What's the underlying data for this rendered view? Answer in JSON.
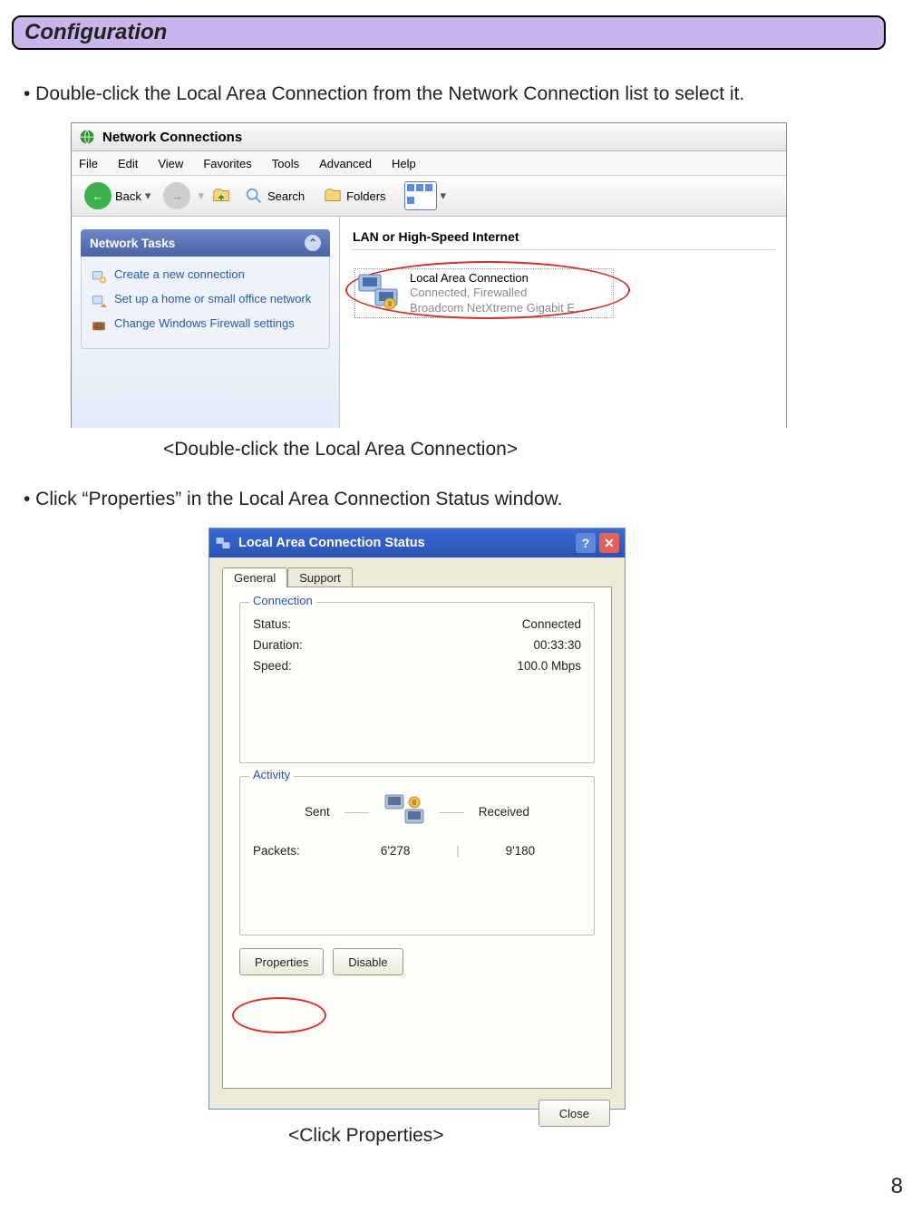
{
  "header": {
    "title": "Configuration"
  },
  "bullets": {
    "b1": "• Double-click the Local Area Connection from the Network Connection list to select it.",
    "b2": "• Click “Properties” in the Local Area Connection Status window."
  },
  "captions": {
    "c1": "<Double-click the Local Area Connection>",
    "c2": "<Click Properties>"
  },
  "page_number": "8",
  "shot1": {
    "title": "Network Connections",
    "menu": [
      "File",
      "Edit",
      "View",
      "Favorites",
      "Tools",
      "Advanced",
      "Help"
    ],
    "toolbar": {
      "back": "Back",
      "search": "Search",
      "folders": "Folders"
    },
    "tasks_header": "Network Tasks",
    "tasks": [
      "Create a new connection",
      "Set up a home or small office network",
      "Change Windows Firewall settings"
    ],
    "section_header": "LAN or High-Speed Internet",
    "lac": {
      "name": "Local Area Connection",
      "status": "Connected, Firewalled",
      "device": "Broadcom NetXtreme Gigabit E..."
    }
  },
  "shot2": {
    "title": "Local Area Connection Status",
    "tabs": {
      "general": "General",
      "support": "Support"
    },
    "connection": {
      "group": "Connection",
      "status_label": "Status:",
      "status_value": "Connected",
      "duration_label": "Duration:",
      "duration_value": "00:33:30",
      "speed_label": "Speed:",
      "speed_value": "100.0 Mbps"
    },
    "activity": {
      "group": "Activity",
      "sent": "Sent",
      "received": "Received",
      "packets_label": "Packets:",
      "packets_sent": "6'278",
      "packets_recv": "9'180"
    },
    "buttons": {
      "properties": "Properties",
      "disable": "Disable",
      "close": "Close"
    }
  }
}
